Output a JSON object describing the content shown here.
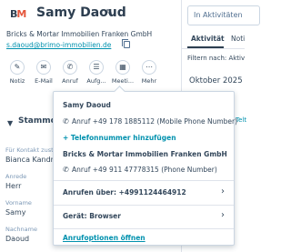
{
  "contact": {
    "name": "Samy Daoud",
    "company_line": "Bricks & Mortar Immobilien Franken GmbH",
    "email": "s.daoud@brimo-immobilien.de"
  },
  "actions": [
    {
      "label": "Notiz",
      "icon": "note-icon"
    },
    {
      "label": "E-Mail",
      "icon": "email-icon"
    },
    {
      "label": "Anruf",
      "icon": "phone-icon"
    },
    {
      "label": "Aufg...",
      "icon": "task-icon"
    },
    {
      "label": "Meeti...",
      "icon": "meeting-icon"
    },
    {
      "label": "Mehr",
      "icon": "more-icon"
    }
  ],
  "about": {
    "title": "Stammda",
    "fields": [
      {
        "label": "Für Kontakt zuständ",
        "value": "Bianca Kandra"
      },
      {
        "label": "Anrede",
        "value": "Herr"
      },
      {
        "label": "Vorname",
        "value": "Samy"
      },
      {
        "label": "Nachname",
        "value": "Daoud"
      }
    ]
  },
  "activity": {
    "search_placeholder": "In Aktivitäten",
    "tabs": [
      "Aktivität",
      "Noti"
    ],
    "filter_text": "Filtern nach: Aktiv",
    "month": "Oktober 2025",
    "side_link": "Telt"
  },
  "call_popover": {
    "contact_title": "Samy Daoud",
    "contact_phone": "Anruf +49 178 1885112 (Mobile Phone Number)",
    "add_phone_label": "+ Telefonnummer hinzufügen",
    "company_title": "Bricks & Mortar Immobilien Franken GmbH",
    "company_phone": "Anruf +49 911 47778315 (Phone Number)",
    "call_via_label": "Anrufen über: +4991124464912",
    "device_label": "Gerät: Browser",
    "options_link": "Anrufoptionen öffnen"
  }
}
